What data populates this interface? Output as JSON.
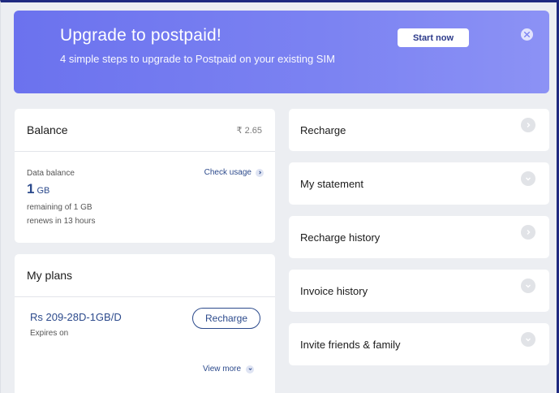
{
  "banner": {
    "title": "Upgrade to postpaid!",
    "subtitle": "4 simple steps to upgrade to Postpaid on your existing SIM",
    "cta_label": "Start now"
  },
  "balance": {
    "title": "Balance",
    "amount": "₹ 2.65",
    "data_label": "Data balance",
    "check_usage": "Check usage",
    "data_value": "1",
    "data_unit": "GB",
    "remaining": "remaining of 1 GB",
    "renews": "renews in 13 hours"
  },
  "plans": {
    "title": "My plans",
    "plan_name": "Rs 209-28D-1GB/D",
    "expires": "Expires on",
    "recharge_label": "Recharge",
    "view_more": "View more"
  },
  "menu": {
    "items": [
      {
        "label": "Recharge",
        "chevron": "right"
      },
      {
        "label": "My statement",
        "chevron": "down"
      },
      {
        "label": "Recharge history",
        "chevron": "right"
      },
      {
        "label": "Invoice history",
        "chevron": "down"
      },
      {
        "label": "Invite friends & family",
        "chevron": "down"
      }
    ]
  },
  "colors": {
    "accent": "#2c4a8c",
    "banner": "#7c83f2",
    "background": "#eceef2"
  }
}
